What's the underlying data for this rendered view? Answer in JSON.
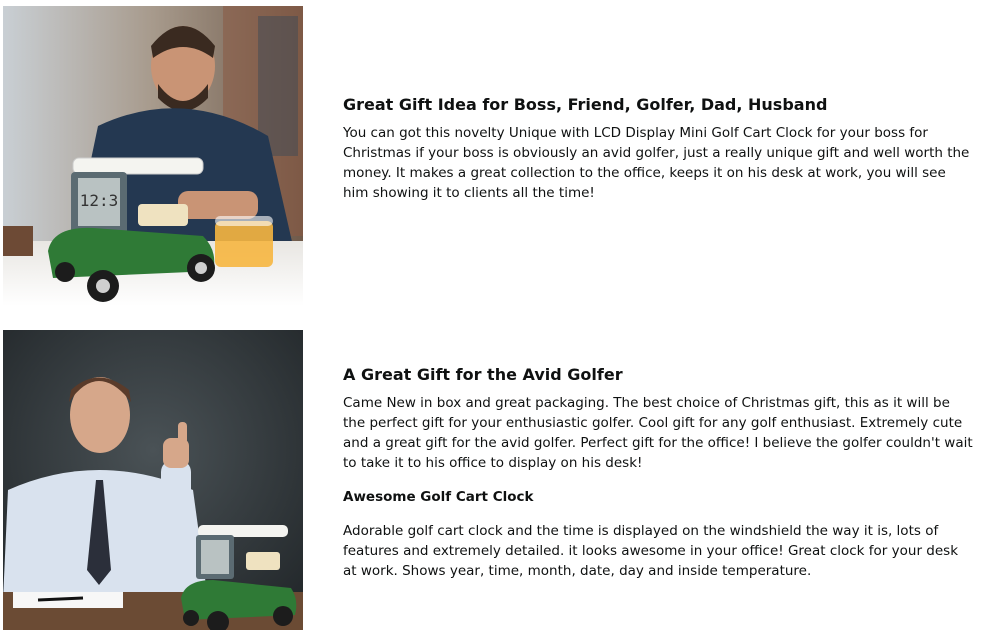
{
  "modules": [
    {
      "image": {
        "subject": "Man at desk with mini golf cart LCD clock and orange juice"
      },
      "heading": "Great Gift Idea for Boss, Friend, Golfer, Dad, Husband",
      "body": "You can got this novelty Unique with LCD Display Mini Golf Cart Clock for your boss for Christmas if your boss is obviously an avid golfer, just a really unique gift and well worth the money. It makes a great collection to the office, keeps it on his desk at work, you will see him showing it to clients all the time!"
    },
    {
      "image": {
        "subject": "Smiling businessman giving thumbs up beside mini golf cart clock"
      },
      "heading": "A Great Gift for the Avid Golfer",
      "body": "Came New in box and great packaging. The best choice of Christmas gift, this as it will be the perfect gift for your enthusiastic golfer. Cool gift for any golf enthusiast. Extremely cute and a great gift for the avid golfer. Perfect gift for the office! I believe the golfer couldn't wait to take it to his office to display on his desk!",
      "subheading": "Awesome Golf Cart Clock",
      "body2": "Adorable golf cart clock and the time is displayed on the windshield the way it is, lots of features and extremely detailed. it looks awesome in your office! Great clock for your desk at work. Shows year, time, month, date, day and inside temperature."
    }
  ],
  "colors": {
    "text": "#0f1111",
    "cart_green": "#2f7a36",
    "cart_roof": "#f4f4f0",
    "chalkboard": "#2e3336"
  }
}
